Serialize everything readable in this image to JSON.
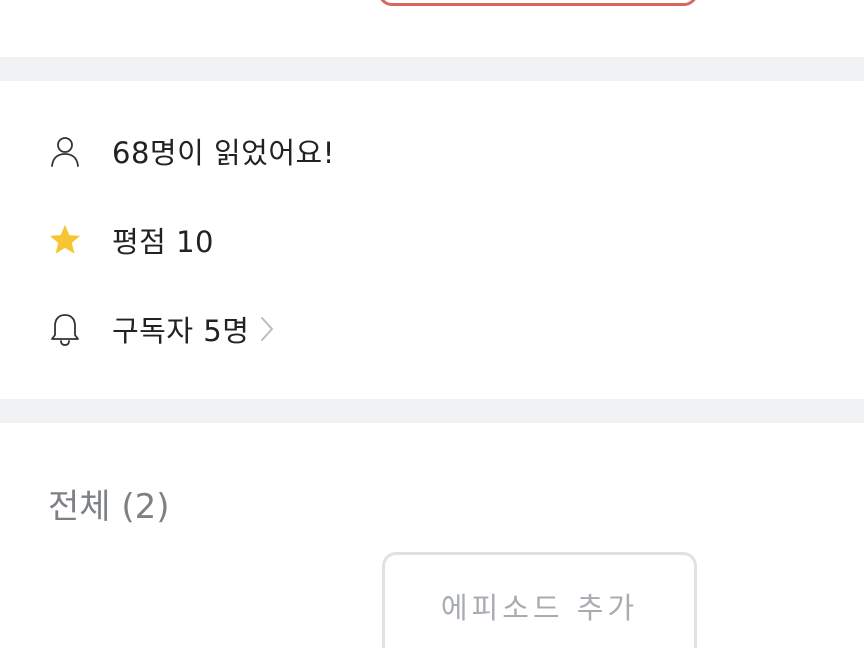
{
  "stats": {
    "readers_text": "68명이 읽었어요!",
    "rating_text": "평점 10",
    "subscribers_text": "구독자 5명"
  },
  "episodes": {
    "title": "전체 (2)",
    "add_button_label": "에피소드 추가"
  },
  "icons": {
    "readers": "person-icon",
    "rating": "star-icon",
    "subscribers": "bell-icon",
    "subscribers_more": "chevron-right-icon"
  },
  "colors": {
    "star": "#f7c531",
    "top_button_border": "#d9665f",
    "divider": "#f1f2f4",
    "muted_text": "#7d8186",
    "button_text": "#a8acb1"
  }
}
